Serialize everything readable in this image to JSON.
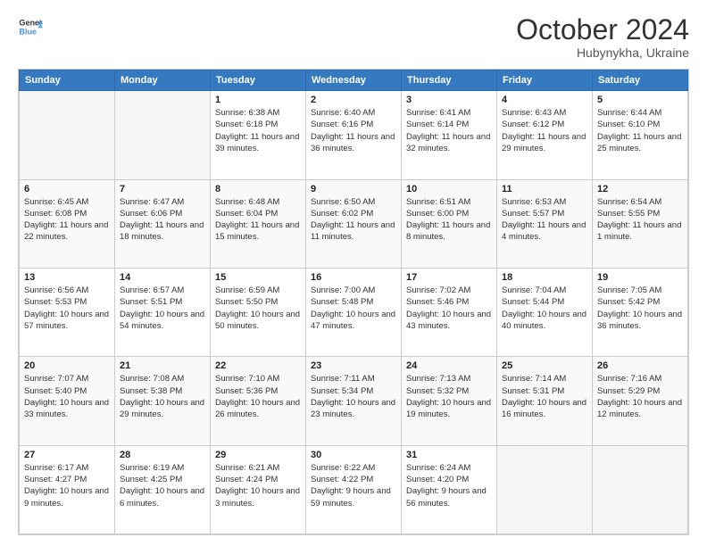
{
  "logo": {
    "line1": "General",
    "line2": "Blue"
  },
  "header": {
    "month_year": "October 2024",
    "location": "Hubynykha, Ukraine"
  },
  "days_of_week": [
    "Sunday",
    "Monday",
    "Tuesday",
    "Wednesday",
    "Thursday",
    "Friday",
    "Saturday"
  ],
  "weeks": [
    [
      {
        "day": "",
        "info": ""
      },
      {
        "day": "",
        "info": ""
      },
      {
        "day": "1",
        "info": "Sunrise: 6:38 AM\nSunset: 6:18 PM\nDaylight: 11 hours and 39 minutes."
      },
      {
        "day": "2",
        "info": "Sunrise: 6:40 AM\nSunset: 6:16 PM\nDaylight: 11 hours and 36 minutes."
      },
      {
        "day": "3",
        "info": "Sunrise: 6:41 AM\nSunset: 6:14 PM\nDaylight: 11 hours and 32 minutes."
      },
      {
        "day": "4",
        "info": "Sunrise: 6:43 AM\nSunset: 6:12 PM\nDaylight: 11 hours and 29 minutes."
      },
      {
        "day": "5",
        "info": "Sunrise: 6:44 AM\nSunset: 6:10 PM\nDaylight: 11 hours and 25 minutes."
      }
    ],
    [
      {
        "day": "6",
        "info": "Sunrise: 6:45 AM\nSunset: 6:08 PM\nDaylight: 11 hours and 22 minutes."
      },
      {
        "day": "7",
        "info": "Sunrise: 6:47 AM\nSunset: 6:06 PM\nDaylight: 11 hours and 18 minutes."
      },
      {
        "day": "8",
        "info": "Sunrise: 6:48 AM\nSunset: 6:04 PM\nDaylight: 11 hours and 15 minutes."
      },
      {
        "day": "9",
        "info": "Sunrise: 6:50 AM\nSunset: 6:02 PM\nDaylight: 11 hours and 11 minutes."
      },
      {
        "day": "10",
        "info": "Sunrise: 6:51 AM\nSunset: 6:00 PM\nDaylight: 11 hours and 8 minutes."
      },
      {
        "day": "11",
        "info": "Sunrise: 6:53 AM\nSunset: 5:57 PM\nDaylight: 11 hours and 4 minutes."
      },
      {
        "day": "12",
        "info": "Sunrise: 6:54 AM\nSunset: 5:55 PM\nDaylight: 11 hours and 1 minute."
      }
    ],
    [
      {
        "day": "13",
        "info": "Sunrise: 6:56 AM\nSunset: 5:53 PM\nDaylight: 10 hours and 57 minutes."
      },
      {
        "day": "14",
        "info": "Sunrise: 6:57 AM\nSunset: 5:51 PM\nDaylight: 10 hours and 54 minutes."
      },
      {
        "day": "15",
        "info": "Sunrise: 6:59 AM\nSunset: 5:50 PM\nDaylight: 10 hours and 50 minutes."
      },
      {
        "day": "16",
        "info": "Sunrise: 7:00 AM\nSunset: 5:48 PM\nDaylight: 10 hours and 47 minutes."
      },
      {
        "day": "17",
        "info": "Sunrise: 7:02 AM\nSunset: 5:46 PM\nDaylight: 10 hours and 43 minutes."
      },
      {
        "day": "18",
        "info": "Sunrise: 7:04 AM\nSunset: 5:44 PM\nDaylight: 10 hours and 40 minutes."
      },
      {
        "day": "19",
        "info": "Sunrise: 7:05 AM\nSunset: 5:42 PM\nDaylight: 10 hours and 36 minutes."
      }
    ],
    [
      {
        "day": "20",
        "info": "Sunrise: 7:07 AM\nSunset: 5:40 PM\nDaylight: 10 hours and 33 minutes."
      },
      {
        "day": "21",
        "info": "Sunrise: 7:08 AM\nSunset: 5:38 PM\nDaylight: 10 hours and 29 minutes."
      },
      {
        "day": "22",
        "info": "Sunrise: 7:10 AM\nSunset: 5:36 PM\nDaylight: 10 hours and 26 minutes."
      },
      {
        "day": "23",
        "info": "Sunrise: 7:11 AM\nSunset: 5:34 PM\nDaylight: 10 hours and 23 minutes."
      },
      {
        "day": "24",
        "info": "Sunrise: 7:13 AM\nSunset: 5:32 PM\nDaylight: 10 hours and 19 minutes."
      },
      {
        "day": "25",
        "info": "Sunrise: 7:14 AM\nSunset: 5:31 PM\nDaylight: 10 hours and 16 minutes."
      },
      {
        "day": "26",
        "info": "Sunrise: 7:16 AM\nSunset: 5:29 PM\nDaylight: 10 hours and 12 minutes."
      }
    ],
    [
      {
        "day": "27",
        "info": "Sunrise: 6:17 AM\nSunset: 4:27 PM\nDaylight: 10 hours and 9 minutes."
      },
      {
        "day": "28",
        "info": "Sunrise: 6:19 AM\nSunset: 4:25 PM\nDaylight: 10 hours and 6 minutes."
      },
      {
        "day": "29",
        "info": "Sunrise: 6:21 AM\nSunset: 4:24 PM\nDaylight: 10 hours and 3 minutes."
      },
      {
        "day": "30",
        "info": "Sunrise: 6:22 AM\nSunset: 4:22 PM\nDaylight: 9 hours and 59 minutes."
      },
      {
        "day": "31",
        "info": "Sunrise: 6:24 AM\nSunset: 4:20 PM\nDaylight: 9 hours and 56 minutes."
      },
      {
        "day": "",
        "info": ""
      },
      {
        "day": "",
        "info": ""
      }
    ]
  ]
}
